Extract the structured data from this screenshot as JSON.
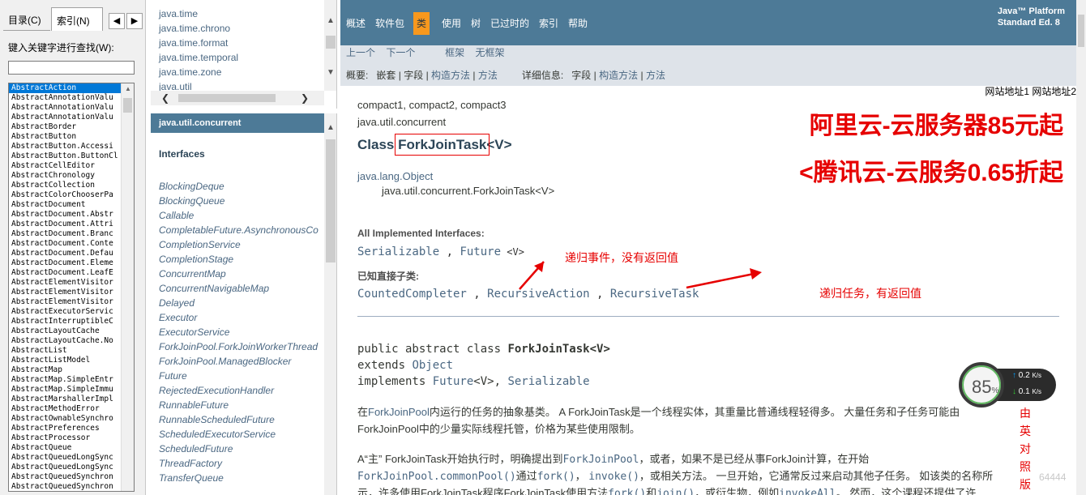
{
  "left_panel": {
    "tab_contents": "目录(C)",
    "tab_index": "索引(N)",
    "nav_prev": "◀",
    "nav_next": "▶",
    "keyword_label": "键入关键字进行查找(W):",
    "keyword_value": "",
    "keywords": [
      "AbstractAction",
      "AbstractAnnotationValu",
      "AbstractAnnotationValu",
      "AbstractAnnotationValu",
      "AbstractBorder",
      "AbstractButton",
      "AbstractButton.Accessi",
      "AbstractButton.ButtonCl",
      "AbstractCellEditor",
      "AbstractChronology",
      "AbstractCollection",
      "AbstractColorChooserPa",
      "AbstractDocument",
      "AbstractDocument.Abstr",
      "AbstractDocument.Attri",
      "AbstractDocument.Branc",
      "AbstractDocument.Conte",
      "AbstractDocument.Defau",
      "AbstractDocument.Eleme",
      "AbstractDocument.LeafE",
      "AbstractElementVisitor",
      "AbstractElementVisitor",
      "AbstractElementVisitor",
      "AbstractExecutorServic",
      "AbstractInterruptibleC",
      "AbstractLayoutCache",
      "AbstractLayoutCache.No",
      "AbstractList",
      "AbstractListModel",
      "AbstractMap",
      "AbstractMap.SimpleEntr",
      "AbstractMap.SimpleImmu",
      "AbstractMarshallerImpl",
      "AbstractMethodError",
      "AbstractOwnableSynchro",
      "AbstractPreferences",
      "AbstractProcessor",
      "AbstractQueue",
      "AbstractQueuedLongSync",
      "AbstractQueuedLongSync",
      "AbstractQueuedSynchron",
      "AbstractQueuedSynchron"
    ]
  },
  "packages": [
    "java.time",
    "java.time.chrono",
    "java.time.format",
    "java.time.temporal",
    "java.time.zone",
    "java.util"
  ],
  "classes_panel": {
    "header": "java.util.concurrent",
    "subheader": "Interfaces",
    "items": [
      "BlockingDeque",
      "BlockingQueue",
      "Callable",
      "CompletableFuture.AsynchronousCo",
      "CompletionService",
      "CompletionStage",
      "ConcurrentMap",
      "ConcurrentNavigableMap",
      "Delayed",
      "Executor",
      "ExecutorService",
      "ForkJoinPool.ForkJoinWorkerThread",
      "ForkJoinPool.ManagedBlocker",
      "Future",
      "RejectedExecutionHandler",
      "RunnableFuture",
      "RunnableScheduledFuture",
      "ScheduledExecutorService",
      "ScheduledFuture",
      "ThreadFactory",
      "TransferQueue"
    ]
  },
  "topnav": {
    "items": [
      "概述",
      "软件包",
      "类",
      "使用",
      "树",
      "已过时的",
      "索引",
      "帮助"
    ],
    "active_index": 2,
    "platform_line1": "Java™ Platform",
    "platform_line2": "Standard Ed. 8"
  },
  "subnav": {
    "prev": "上一个",
    "next": "下一个",
    "frames": "框架",
    "noframes": "无框架",
    "summary_label": "概要:",
    "summary_nested": "嵌套",
    "summary_field": "字段",
    "summary_ctor": "构造方法",
    "summary_method": "方法",
    "detail_label": "详细信息:",
    "detail_field": "字段",
    "detail_ctor": "构造方法",
    "detail_method": "方法",
    "sep": "|"
  },
  "right_links": "网站地址1 网站地址2",
  "doc": {
    "profiles": "compact1, compact2, compact3",
    "package": "java.util.concurrent",
    "class_prefix": "Class ",
    "class_name": "ForkJoinTask",
    "class_generic": "<V>",
    "inherit_root": "java.lang.Object",
    "inherit_self": "java.util.concurrent.ForkJoinTask<V>",
    "implemented_label": "All Implemented Interfaces:",
    "implemented_1": "Serializable",
    "implemented_sep": " , ",
    "implemented_2": "Future",
    "implemented_2_generic": " <V>",
    "subclasses_label": "已知直接子类:",
    "subclass_1": "CountedCompleter",
    "subclass_2": "RecursiveAction",
    "subclass_3": "RecursiveTask",
    "sig_1_prefix": "public abstract class ",
    "sig_1_name": "ForkJoinTask<V>",
    "sig_2_prefix": "extends ",
    "sig_2_type": "Object",
    "sig_3_prefix": "implements ",
    "sig_3_type1": "Future",
    "sig_3_mid": "<V>, ",
    "sig_3_type2": "Serializable",
    "para1_a": "在",
    "para1_link": "ForkJoinPool",
    "para1_b": "内运行的任务的抽象基类。 A ForkJoinTask是一个线程实体，其重量比普通线程轻得多。 大量任务和子任务可能由",
    "para1_c": "ForkJoinPool中的少量实际线程托管，价格为某些使用限制。",
    "para2_a": "A“主” ForkJoinTask开始执行时，明确提出到",
    "para2_link1": "ForkJoinPool",
    "para2_b": "，或者，如果不是已经从事ForkJoin计算，在开始",
    "para2_link2": "ForkJoinPool.commonPool()",
    "para2_c": "通过",
    "para2_link3": "fork()",
    "para2_d": "，  ",
    "para2_link4": "invoke()",
    "para2_e": "，或相关方法。 一旦开始，它通常反过来启动其他子任务。 如该类的名称所",
    "para3_a": "示，许多使用ForkJoinTask程序ForkJoinTask使用方法",
    "para3_link1": "fork()",
    "para3_b": "和",
    "para3_link2": "join()",
    "para3_c": "，或衍生物，例如",
    "para3_link3": "invokeAll",
    "para3_d": "。 然而，这个课程还提供了许"
  },
  "overlays": {
    "promo_1": "阿里云-云服务器85元起",
    "promo_2": "<腾讯云-云服务0.65折起",
    "note_action": "递归事件，没有返回值",
    "note_task": "递归任务，有返回值",
    "vertical_note": "单由英对照版",
    "watermark": "64444"
  },
  "speed_widget": {
    "percent": "85",
    "percent_unit": "%",
    "up": "0.2",
    "down": "0.1",
    "unit": "K/s"
  },
  "colors": {
    "nav_bg": "#4d7a97",
    "nav_active": "#f8981d",
    "subnav_bg": "#dee3e9",
    "link": "#4a6782",
    "annotation": "#e60000"
  }
}
